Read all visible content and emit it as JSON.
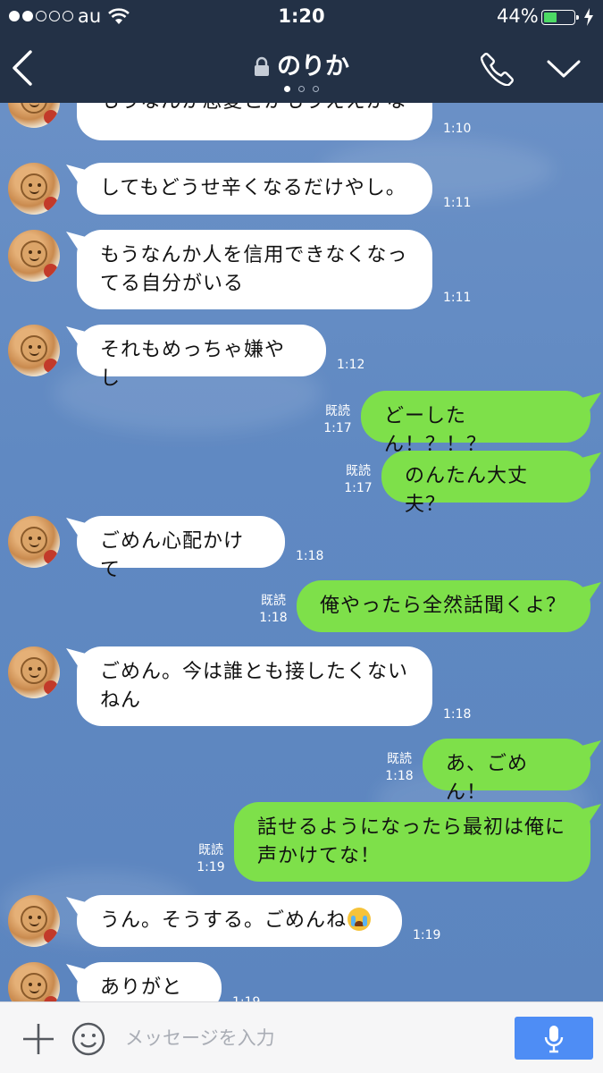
{
  "status_bar": {
    "carrier": "au",
    "time": "1:20",
    "battery_percent": "44%",
    "battery_level": 0.44,
    "signal_bars": 2
  },
  "header": {
    "title": "のりか",
    "page_indicator": {
      "count": 3,
      "active": 1
    }
  },
  "messages": [
    {
      "side": "in",
      "text": "もうなんか恋愛とかもうええかな",
      "time": "1:10"
    },
    {
      "side": "in",
      "text": "してもどうせ辛くなるだけやし。",
      "time": "1:11"
    },
    {
      "side": "in",
      "text": "もうなんか人を信用できなくなってる自分がいる",
      "time": "1:11"
    },
    {
      "side": "in",
      "text": "それもめっちゃ嫌やし",
      "time": "1:12"
    },
    {
      "side": "out",
      "text": "どーしたん！？！？",
      "read": "既読",
      "time": "1:17"
    },
    {
      "side": "out",
      "text": "のんたん大丈夫？",
      "read": "既読",
      "time": "1:17"
    },
    {
      "side": "in",
      "text": "ごめん心配かけて",
      "time": "1:18"
    },
    {
      "side": "out",
      "text": "俺やったら全然話聞くよ？",
      "read": "既読",
      "time": "1:18"
    },
    {
      "side": "in",
      "text": "ごめん。今は誰とも接したくないねん",
      "time": "1:18"
    },
    {
      "side": "out",
      "text": "あ、ごめん！",
      "read": "既読",
      "time": "1:18"
    },
    {
      "side": "out",
      "text": "話せるようになったら最初は俺に声かけてな！",
      "read": "既読",
      "time": "1:19"
    },
    {
      "side": "in",
      "text": "うん。そうする。ごめんね",
      "emoji": "crying-face",
      "time": "1:19"
    },
    {
      "side": "in",
      "text": "ありがとう",
      "time": "1:19"
    }
  ],
  "input_bar": {
    "placeholder": "メッセージを入力"
  },
  "colors": {
    "header_bg": "#233146",
    "chat_bg": "#6089c2",
    "bubble_in": "#ffffff",
    "bubble_out": "#7ee04a",
    "mic_button": "#4e8df5",
    "battery_fill": "#4cd964"
  }
}
